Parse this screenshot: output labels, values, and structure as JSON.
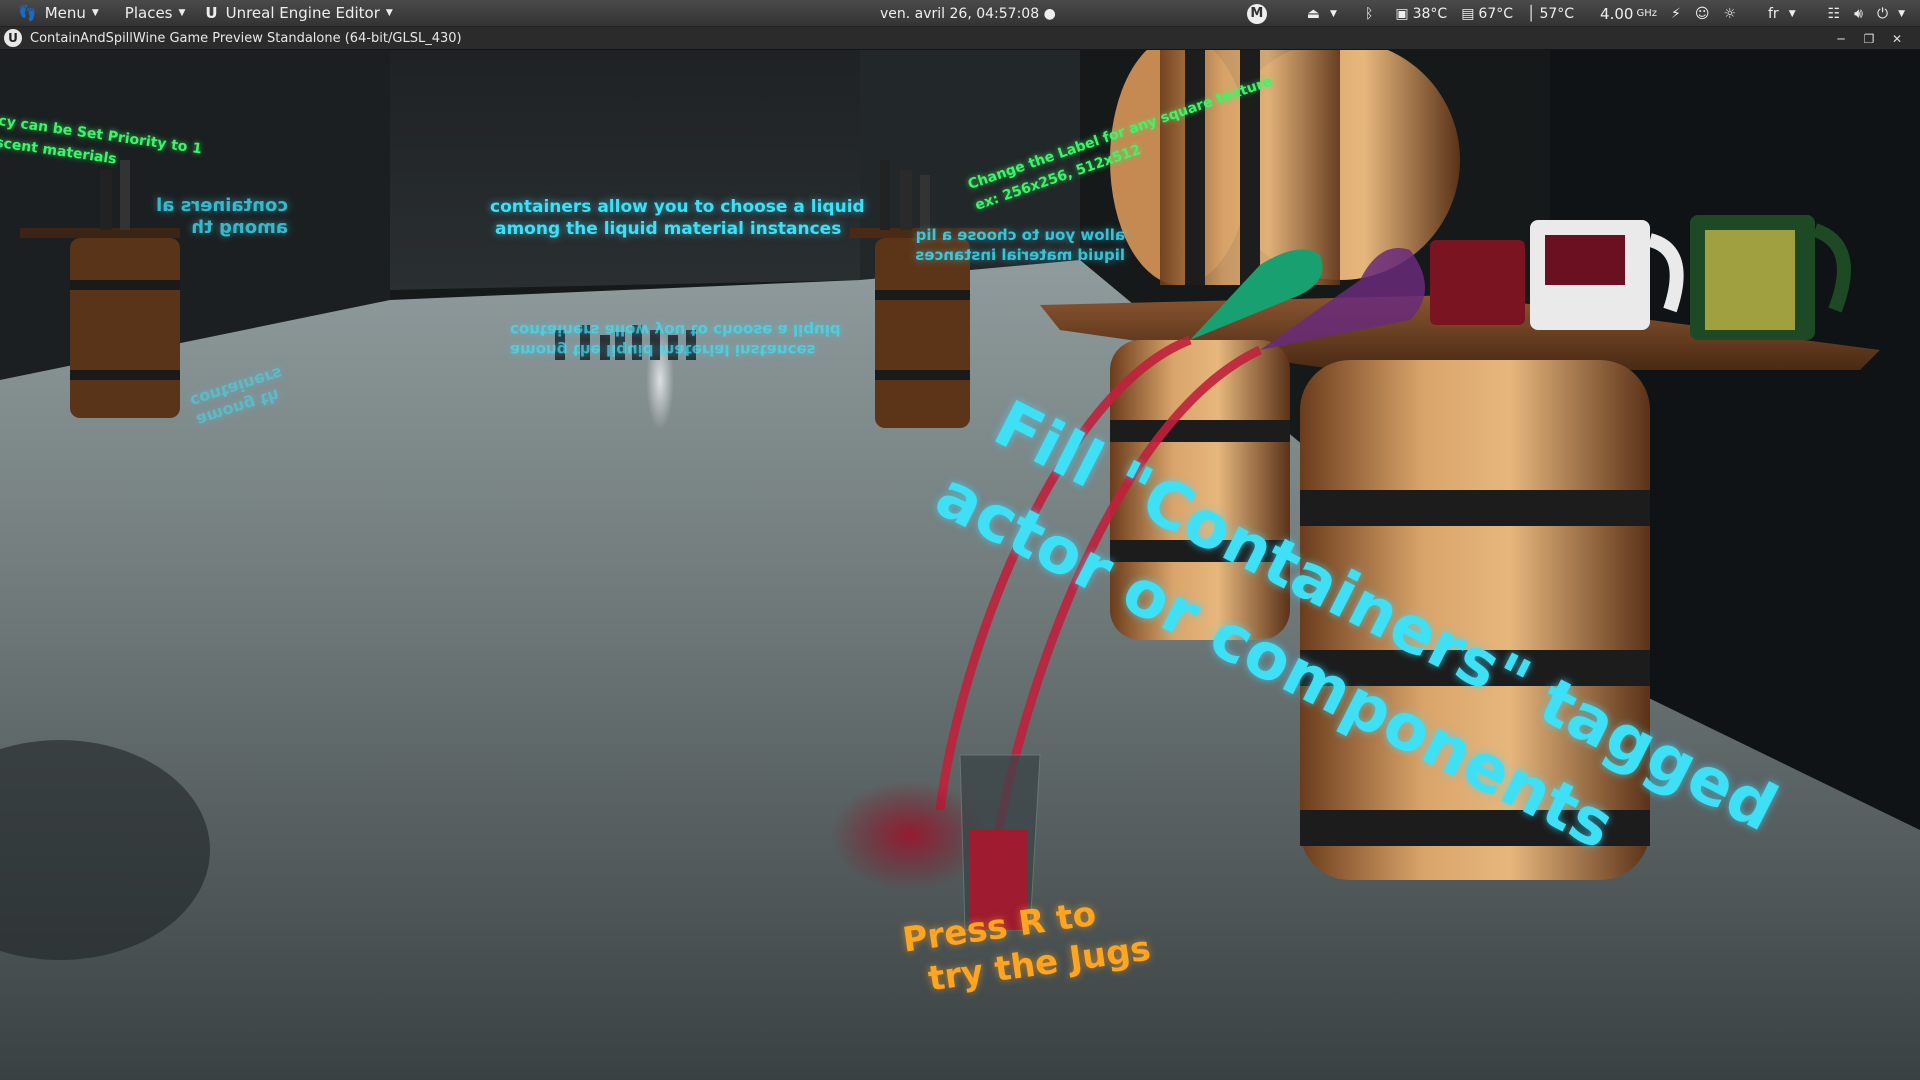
{
  "panel": {
    "menu_label": "Menu",
    "places_label": "Places",
    "app_label": "Unreal Engine Editor",
    "clock": "ven. avril 26, 04:57:08 ●",
    "indicator_m": "M",
    "cpu_temp": "38°C",
    "gpu_temp": "67°C",
    "disk_temp": "57°C",
    "cpu_freq": "4.00",
    "freq_unit": "GHz",
    "keyboard_layout": "fr"
  },
  "window": {
    "title": "ContainAndSpillWine Game Preview Standalone (64-bit/GLSL_430)",
    "logo": "U"
  },
  "scene": {
    "wall_center_text_1": "containers allow you to choose a liquid",
    "wall_center_text_2": "among the liquid material instances",
    "reflection_text_1": "among the liquid material instances",
    "reflection_text_2": "containers allow you to choose a liquid",
    "left_wall_text_1": "containers al",
    "left_wall_text_2": "among th",
    "left_wall_reflect_1": "among th",
    "left_wall_reflect_2": "containers",
    "green_left_1": "cy can be Set Priority to 1",
    "green_left_2": "scent materials",
    "green_right_1": "Change the Label for any square texture",
    "green_right_2": "ex: 256x256, 512x512",
    "right_wall_text_1": "allow you to choose a liq",
    "right_wall_text_2": "liquid material instances",
    "floor_big_1": "Fill \"Containers\" tagged",
    "floor_big_2": "actor or components",
    "press_r_1": "Press R to",
    "press_r_2": "try the Jugs"
  },
  "colors": {
    "neon_cyan": "#3ee0f5",
    "neon_green": "#3cf56a",
    "orange": "#ffa51f",
    "wine": "#c0203c"
  }
}
